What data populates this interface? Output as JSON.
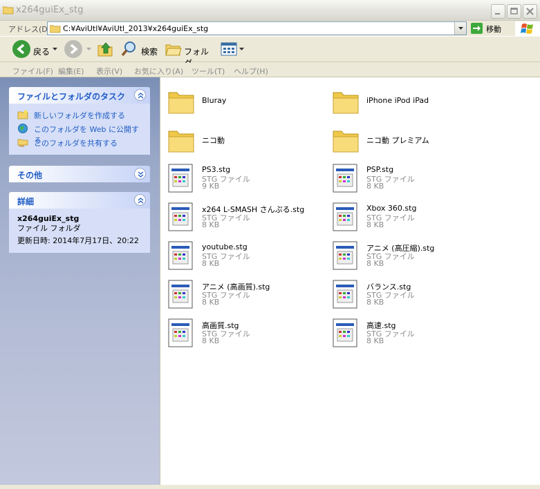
{
  "window": {
    "title": "x264guiEx_stg",
    "controls": [
      "minimize",
      "maximize",
      "close"
    ]
  },
  "address": {
    "label": "アドレス(D)",
    "path": "C:¥AviUtl¥AviUtl_2013¥x264guiEx_stg",
    "go_label": "移動"
  },
  "toolbar": {
    "back_label": "戻る",
    "search_label": "検索",
    "folders_label": "フォルダ"
  },
  "menu": [
    {
      "label": "ファイル(F)"
    },
    {
      "label": "編集(E)"
    },
    {
      "label": "表示(V)"
    },
    {
      "label": "お気に入り(A)"
    },
    {
      "label": "ツール(T)"
    },
    {
      "label": "ヘルプ(H)"
    }
  ],
  "taskpane": {
    "file_tasks": {
      "title": "ファイルとフォルダのタスク",
      "items": [
        {
          "label": "新しいフォルダを作成する",
          "icon": "new-folder-icon"
        },
        {
          "label": "このフォルダを Web に公開する",
          "icon": "publish-web-icon"
        },
        {
          "label": "このフォルダを共有する",
          "icon": "share-folder-icon"
        }
      ]
    },
    "other": {
      "title": "その他"
    },
    "details": {
      "title": "詳細",
      "name": "x264guiEx_stg",
      "type": "ファイル フォルダ",
      "modified": "更新日時: 2014年7月17日、20:22"
    }
  },
  "files": [
    {
      "name": "Bluray",
      "kind": "folder"
    },
    {
      "name": "iPhone iPod iPad",
      "kind": "folder"
    },
    {
      "name": "ニコ動",
      "kind": "folder"
    },
    {
      "name": "ニコ動 プレミアム",
      "kind": "folder"
    },
    {
      "name": "PS3.stg",
      "kind": "file",
      "type": "STG ファイル",
      "size": "9 KB"
    },
    {
      "name": "PSP.stg",
      "kind": "file",
      "type": "STG ファイル",
      "size": "8 KB"
    },
    {
      "name": "x264 L-SMASH さんぷる.stg",
      "kind": "file",
      "type": "STG ファイル",
      "size": "8 KB"
    },
    {
      "name": "Xbox 360.stg",
      "kind": "file",
      "type": "STG ファイル",
      "size": "8 KB"
    },
    {
      "name": "youtube.stg",
      "kind": "file",
      "type": "STG ファイル",
      "size": "8 KB"
    },
    {
      "name": "アニメ (高圧縮).stg",
      "kind": "file",
      "type": "STG ファイル",
      "size": "8 KB"
    },
    {
      "name": "アニメ (高画質).stg",
      "kind": "file",
      "type": "STG ファイル",
      "size": "8 KB"
    },
    {
      "name": "バランス.stg",
      "kind": "file",
      "type": "STG ファイル",
      "size": "8 KB"
    },
    {
      "name": "高画質.stg",
      "kind": "file",
      "type": "STG ファイル",
      "size": "8 KB"
    },
    {
      "name": "高速.stg",
      "kind": "file",
      "type": "STG ファイル",
      "size": "8 KB"
    }
  ]
}
